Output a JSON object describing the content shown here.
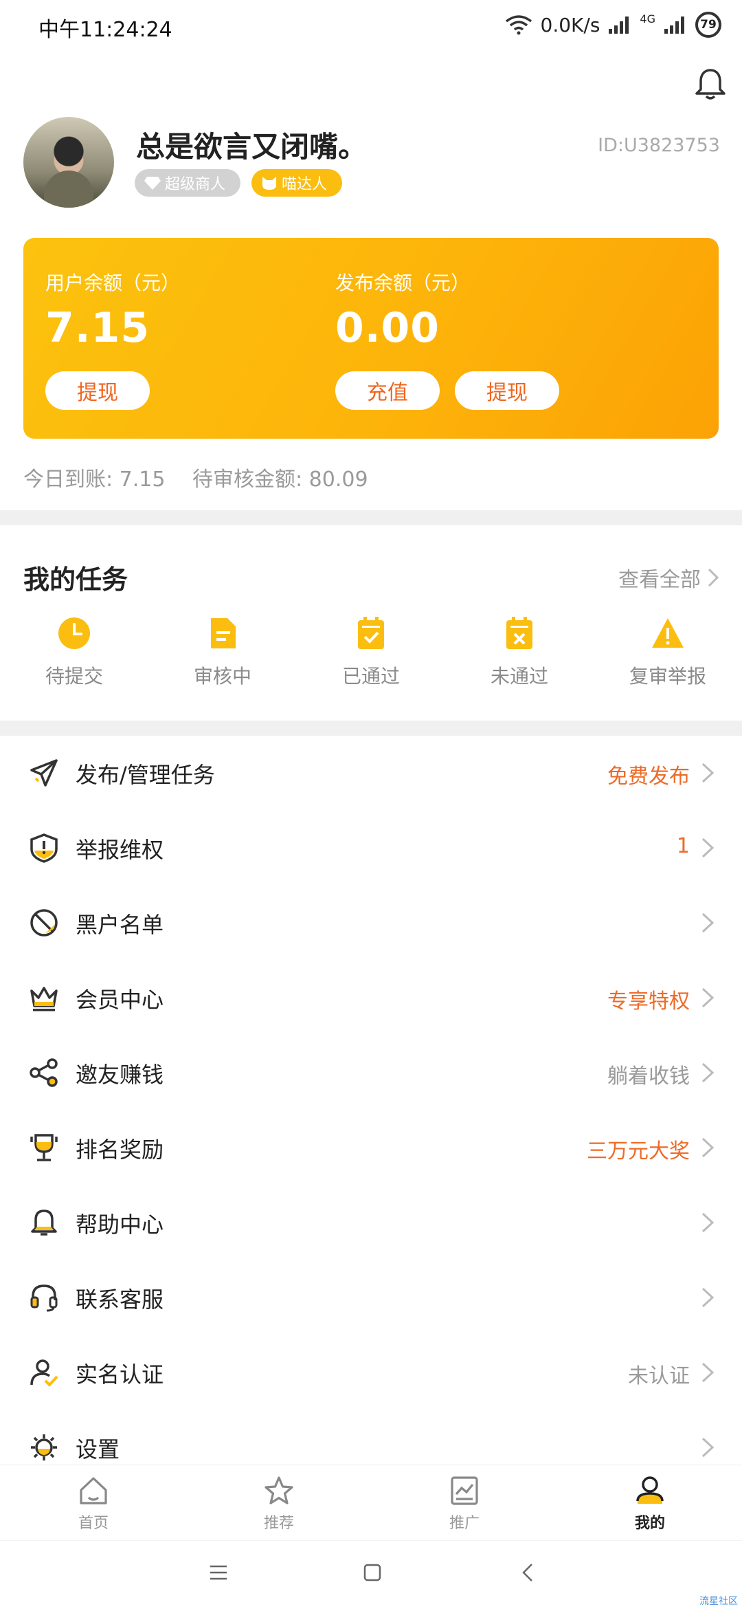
{
  "status_bar": {
    "time": "中午11:24:24",
    "network_speed": "0.0K/s",
    "network_type": "4G",
    "battery": "79"
  },
  "profile": {
    "nickname": "总是欲言又闭嘴。",
    "badges": [
      "超级商人",
      "喵达人"
    ],
    "user_id": "ID:U3823753"
  },
  "balance_card": {
    "user_balance_label": "用户余额（元）",
    "user_balance_amount": "7.15",
    "withdraw_label": "提现",
    "publish_balance_label": "发布余额（元）",
    "publish_balance_amount": "0.00",
    "recharge_label": "充值",
    "publish_withdraw_label": "提现"
  },
  "summary": {
    "today_text": "今日到账: 7.15",
    "pending_text": "待审核金额: 80.09"
  },
  "tasks": {
    "title": "我的任务",
    "view_all": "查看全部",
    "items": [
      {
        "label": "待提交",
        "icon": "clock-icon"
      },
      {
        "label": "审核中",
        "icon": "document-icon"
      },
      {
        "label": "已通过",
        "icon": "check-clipboard-icon"
      },
      {
        "label": "未通过",
        "icon": "x-clipboard-icon"
      },
      {
        "label": "复审举报",
        "icon": "warning-icon"
      }
    ]
  },
  "menu": [
    {
      "label": "发布/管理任务",
      "value": "免费发布",
      "icon": "paper-plane-icon"
    },
    {
      "label": "举报维权",
      "value": "1",
      "icon": "shield-alert-icon"
    },
    {
      "label": "黑户名单",
      "value": "",
      "icon": "blocked-icon"
    },
    {
      "label": "会员中心",
      "value": "专享特权",
      "icon": "crown-icon"
    },
    {
      "label": "邀友赚钱",
      "value": "躺着收钱",
      "icon": "share-icon"
    },
    {
      "label": "排名奖励",
      "value": "三万元大奖",
      "icon": "trophy-icon"
    },
    {
      "label": "帮助中心",
      "value": "",
      "icon": "help-bell-icon"
    },
    {
      "label": "联系客服",
      "value": "",
      "icon": "headset-icon"
    },
    {
      "label": "实名认证",
      "value": "未认证",
      "icon": "user-verify-icon"
    },
    {
      "label": "设置",
      "value": "",
      "icon": "gear-icon"
    }
  ],
  "bottom_nav": {
    "tabs": [
      {
        "label": "首页",
        "icon": "home-icon"
      },
      {
        "label": "推荐",
        "icon": "star-icon"
      },
      {
        "label": "推广",
        "icon": "chart-icon"
      },
      {
        "label": "我的",
        "icon": "profile-icon"
      }
    ],
    "active": "我的"
  },
  "watermark": "流星社区",
  "colors": {
    "accent": "#fbbe10",
    "card_gradient_end": "#fca205",
    "highlight_text": "#ee6a26",
    "muted_text": "#9a9a9a"
  }
}
